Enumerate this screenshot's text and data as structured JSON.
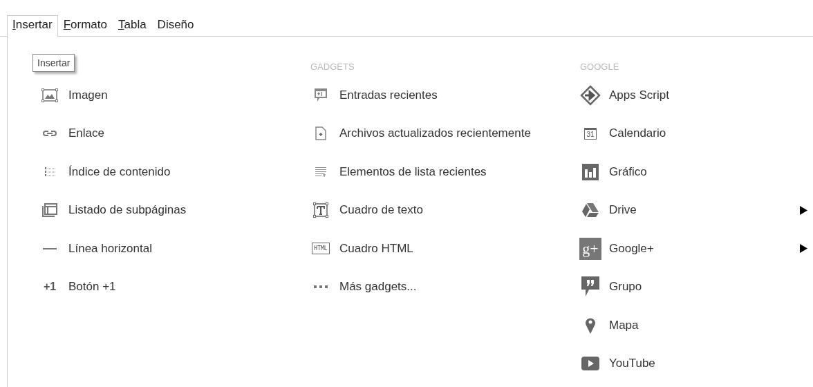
{
  "menu_tabs": [
    {
      "label": "Insertar",
      "mnemonic": true,
      "selected": true
    },
    {
      "label": "Formato",
      "mnemonic": true,
      "selected": false
    },
    {
      "label": "Tabla",
      "mnemonic": true,
      "selected": false
    },
    {
      "label": "Diseño",
      "mnemonic": false,
      "selected": false
    }
  ],
  "tooltip": "Insertar",
  "columns": [
    {
      "items": [
        {
          "label": "Imagen",
          "submenu": false
        },
        {
          "label": "Enlace",
          "submenu": false
        },
        {
          "label": "Índice de contenido",
          "submenu": false
        },
        {
          "label": "Listado de subpáginas",
          "submenu": false
        },
        {
          "label": "Línea horizontal",
          "submenu": false
        },
        {
          "label": "Botón +1",
          "glyph": "+1",
          "submenu": false
        }
      ]
    },
    {
      "header": "GADGETS",
      "items": [
        {
          "label": "Entradas recientes",
          "submenu": false
        },
        {
          "label": "Archivos actualizados recientemente",
          "submenu": false
        },
        {
          "label": "Elementos de lista recientes",
          "submenu": false
        },
        {
          "label": "Cuadro de texto",
          "submenu": false
        },
        {
          "label": "Cuadro HTML",
          "glyph": "HTML",
          "submenu": false
        },
        {
          "label": "Más gadgets...",
          "submenu": false
        }
      ]
    },
    {
      "header": "GOOGLE",
      "items": [
        {
          "label": "Apps Script",
          "submenu": false
        },
        {
          "label": "Calendario",
          "glyph": "31",
          "submenu": false
        },
        {
          "label": "Gráfico",
          "submenu": false
        },
        {
          "label": "Drive",
          "submenu": true
        },
        {
          "label": "Google+",
          "glyph": "g+",
          "submenu": true
        },
        {
          "label": "Grupo",
          "submenu": false
        },
        {
          "label": "Mapa",
          "submenu": false
        },
        {
          "label": "YouTube",
          "submenu": false
        }
      ]
    }
  ]
}
